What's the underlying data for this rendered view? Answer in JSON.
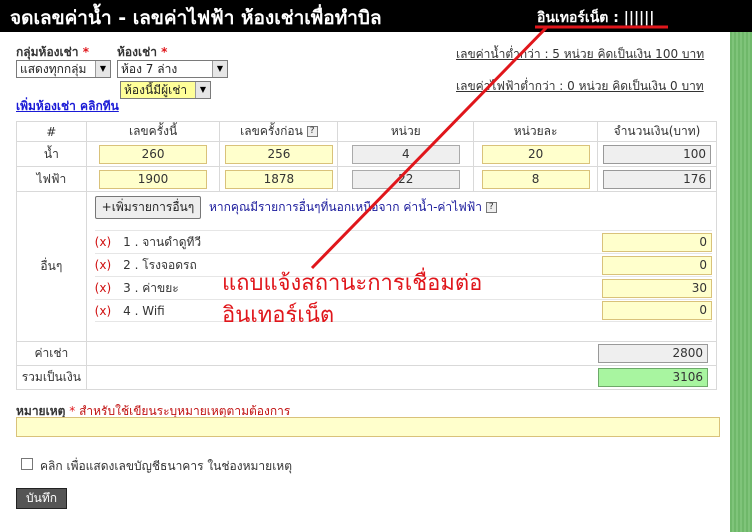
{
  "header": {
    "title": "จดเลขค่าน้ำ - เลขค่าไฟฟ้า ห้องเช่าเพื่อทำบิล",
    "internet_status": "อินเทอร์เน็ต : ||||||"
  },
  "filters": {
    "group_label": "กลุ่มห้องเช่า",
    "group_value": "แสดงทุกกลุ่ม",
    "room_label": "ห้องเช่า",
    "room_value": "ห้อง 7 ล่าง",
    "occupancy_value": "ห้องนี้มีผู้เช่า",
    "required_mark": "*"
  },
  "add_room_link": "เพิ่มห้องเช่า คลิกทีน",
  "rules": {
    "water_rule": "เลขค่าน้ำต่ำกว่า : 5 หน่วย คิดเป็นเงิน 100 บาท",
    "electric_rule": "เลขค่าไฟฟ้าต่ำกว่า : 0 หน่วย คิดเป็นเงิน 0 บาท"
  },
  "table": {
    "headers": [
      "#",
      "เลขครั้งนี้",
      "เลขครั้งก่อน",
      "หน่วย",
      "หน่วยละ",
      "จำนวนเงิน(บาท)"
    ],
    "help_glyph": "?",
    "rows": [
      {
        "label": "น้ำ",
        "current": "260",
        "previous": "256",
        "units": "4",
        "rate": "20",
        "amount": "100"
      },
      {
        "label": "ไฟฟ้า",
        "current": "1900",
        "previous": "1878",
        "units": "22",
        "rate": "8",
        "amount": "176"
      }
    ],
    "other": {
      "label": "อื่นๆ",
      "add_button": "+เพิ่มรายการอื่นๆ",
      "hint": "หากคุณมีรายการอื่นๆที่นอกเหนือจาก ค่าน้ำ-ค่าไฟฟ้า",
      "remove_glyph": "(x)",
      "items": [
        {
          "name": "1 . จานดำดูทีวี",
          "amount": "0"
        },
        {
          "name": "2 . โรงจอดรถ",
          "amount": "0"
        },
        {
          "name": "3 . ค่าขยะ",
          "amount": "30"
        },
        {
          "name": "4 . Wifi",
          "amount": "0"
        }
      ]
    },
    "rent": {
      "label": "ค่าเช่า",
      "amount": "2800"
    },
    "total": {
      "label": "รวมเป็นเงิน",
      "amount": "3106"
    }
  },
  "note": {
    "label": "หมายเหตุ",
    "hint": "สำหรับใช้เขียนระบุหมายเหตุตามต้องการ"
  },
  "bank_checkbox_label": "คลิก เพื่อแสดงเลขบัญชีธนาคาร ในช่องหมายเหตุ",
  "save_button": "บันทึก",
  "annotation": {
    "line1": "แถบแจ้งสถานะการเชื่อมต่อ",
    "line2": "อินเทอร์เน็ต",
    "color": "#e0161b"
  },
  "colors": {
    "titlebar": "#000000",
    "background_stripes": "#7fc47a",
    "input_yellow": "#ffffcc",
    "total_green": "#a8f5a0"
  }
}
